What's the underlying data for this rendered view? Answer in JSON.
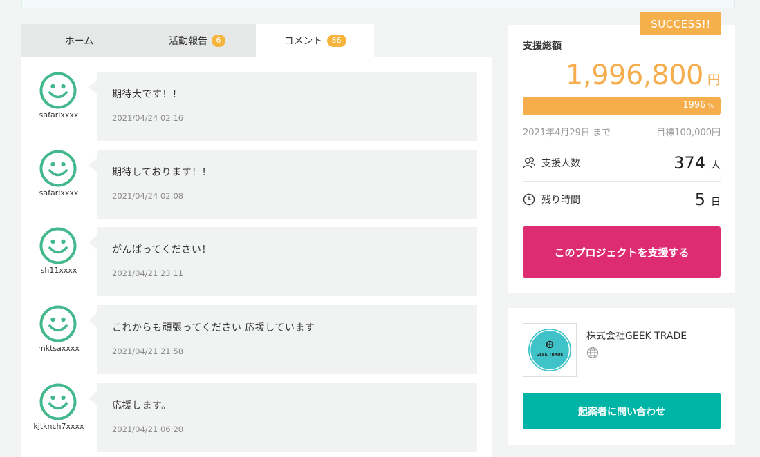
{
  "tabs": [
    {
      "label": "ホーム",
      "badge": null
    },
    {
      "label": "活動報告",
      "badge": "6"
    },
    {
      "label": "コメント",
      "badge": "86"
    }
  ],
  "comments": [
    {
      "user": "safarixxxx",
      "text": "期待大です！！",
      "date": "2021/04/24 02:16"
    },
    {
      "user": "safarixxxx",
      "text": "期待しております！！",
      "date": "2021/04/24 02:08"
    },
    {
      "user": "sh11xxxx",
      "text": "がんばってください！",
      "date": "2021/04/21 23:11"
    },
    {
      "user": "mktsaxxxx",
      "text": "これからも頑張ってください 応援しています",
      "date": "2021/04/21 21:58"
    },
    {
      "user": "kjtknch7xxxx",
      "text": "応援します。",
      "date": "2021/04/21 06:20"
    }
  ],
  "funding": {
    "status_badge": "SUCCESS!!",
    "label": "支援総額",
    "amount": "1,996,800",
    "currency": "円",
    "progress_text": "1996",
    "progress_unit": "%",
    "progress_fraction": 1.0,
    "deadline": "2021年4月29日 まで",
    "goal": "目標100,000円",
    "supporters_label": "支援人数",
    "supporters_count": "374",
    "supporters_unit": "人",
    "remaining_label": "残り時間",
    "remaining_value": "5",
    "remaining_unit": "日",
    "support_button": "このプロジェクトを支援する"
  },
  "owner": {
    "logo_text": "GEEK TRADE",
    "company_name": "株式会社GEEK TRADE",
    "contact_button": "起案者に問い合わせ"
  },
  "colors": {
    "accent_orange": "#f5ae4b",
    "support_pink": "#de2c72",
    "contact_teal": "#00b5a6",
    "avatar_green": "#43b88c"
  }
}
